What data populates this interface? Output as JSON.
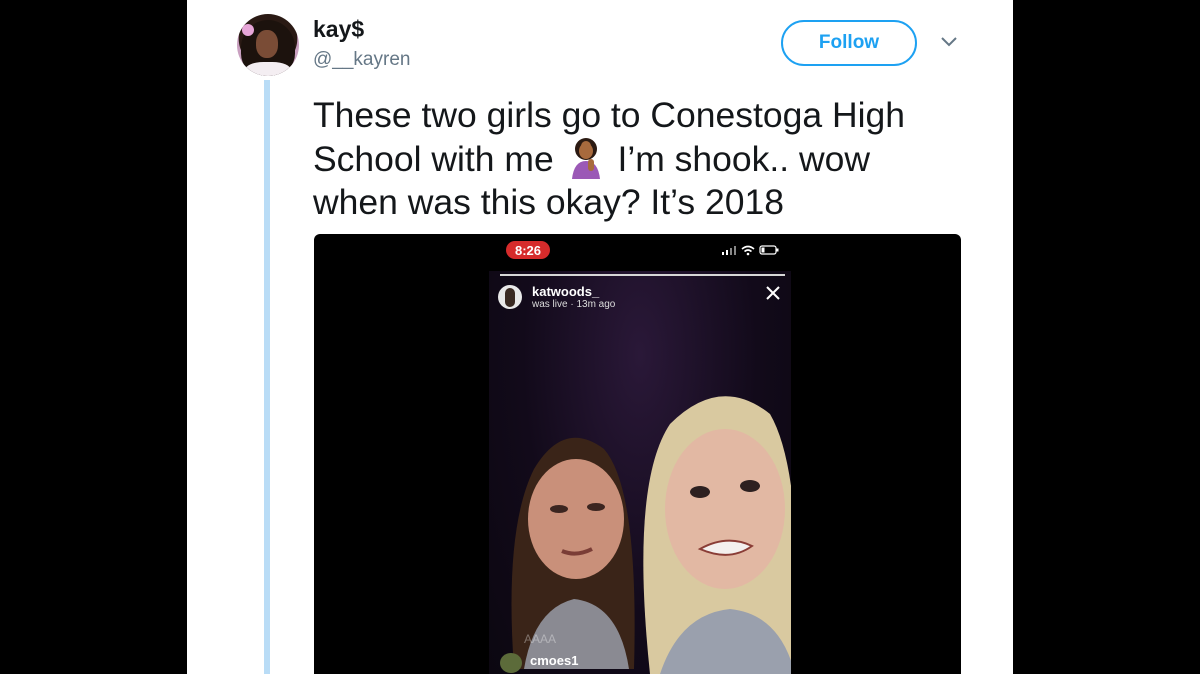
{
  "tweet": {
    "display_name": "kay$",
    "handle": "@__kayren",
    "follow_label": "Follow",
    "text_part1": "These two girls go to Conestoga High School with me",
    "emoji": "🤦🏾‍♀️",
    "text_part2": "I’m shook.. wow when was this okay? It’s 2018"
  },
  "media": {
    "status_time": "8:26",
    "live_username": "katwoods_",
    "live_status": "was live · 13m ago",
    "comment_ghost": "AAAA",
    "comment_user": "cmoes1"
  },
  "icons": {
    "more": "chevron-down-icon",
    "close": "close-icon",
    "facepalm": "woman-facepalming-emoji",
    "status": "signal-wifi-battery-icons"
  },
  "colors": {
    "brand_blue": "#1da1f2",
    "thread_line": "#b9dcf6",
    "live_red": "#d62b2b"
  }
}
